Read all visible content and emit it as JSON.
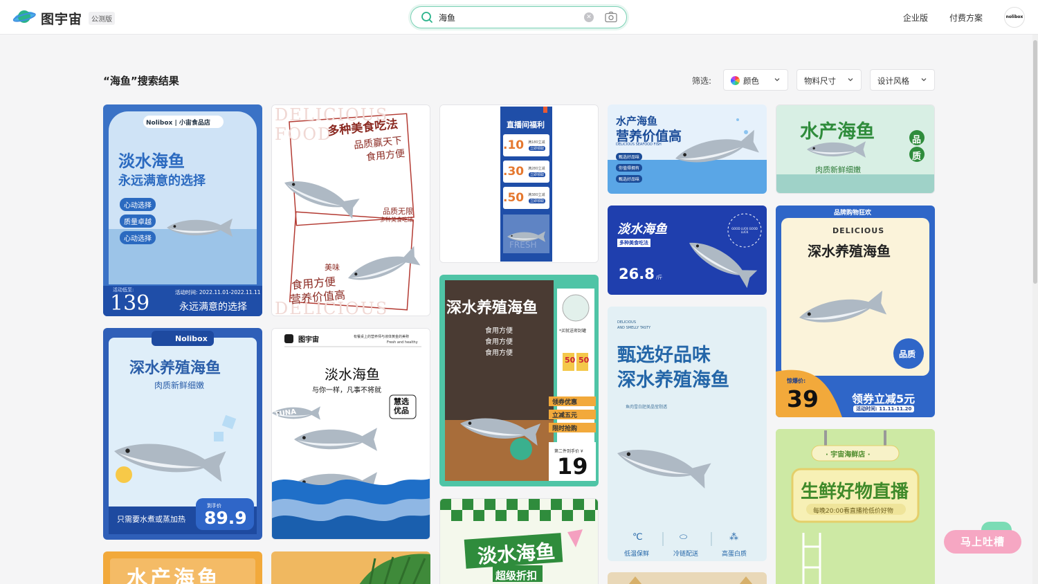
{
  "header": {
    "brand": "图宇宙",
    "beta_badge": "公测版",
    "search": {
      "value": "海鱼",
      "placeholder": ""
    },
    "nav": [
      "企业版",
      "付费方案"
    ],
    "avatar": "nolibox"
  },
  "results": {
    "title": "“海鱼”搜索结果",
    "filter_label": "筛选:",
    "filters": [
      "颜色",
      "物料尺寸",
      "设计风格"
    ]
  },
  "cards": [
    {
      "badge": "Nolibox | 小宙食品店",
      "title": "淡水海鱼",
      "subtitle": "永远满意的选择",
      "tags": [
        "心动选择",
        "质量卓越",
        "心动选择"
      ],
      "price_label": "活动低至:",
      "date": "活动时间: 2022.11.01-2022.11.11",
      "price": "139",
      "tagline": "永远满意的选择"
    },
    {
      "watermark": "DELICIOUS FOOD",
      "line1": "多种美食吃法",
      "line2": "品质赢天下",
      "line3": "食用方便",
      "line4": "品质无限",
      "line5": "多种美食吃法",
      "line6": "美味",
      "line7": "食用方便",
      "line8": "营养价值高"
    },
    {
      "title": "直播间福利",
      "coupons": [
        ".10",
        ".30",
        ".50"
      ],
      "coupon_notes": [
        "满180立减",
        "满280立减",
        "满380立减"
      ],
      "btn": "立即领取",
      "fresh": "FRESH"
    },
    {
      "title1": "水产海鱼",
      "title2": "营养价值高",
      "sub": "DELICIOUS SEAFOOD FISH",
      "tags": [
        "甄选好品味",
        "你值得拥有",
        "甄选好品味"
      ]
    },
    {
      "title": "水产海鱼",
      "badge": [
        "品",
        "质"
      ],
      "sub": "肉质新鲜细嫩"
    },
    {
      "title": "淡水海鱼",
      "sub": "多种美食吃法",
      "price": "26.8",
      "unit": "/斤",
      "ring": "GOOD LUCK GOOD LUCK"
    },
    {
      "top": "品牌购物狂欢",
      "en": "DELICIOUS",
      "title": "深水养殖海鱼",
      "badge": "品质",
      "burst": "惊爆价:",
      "price": "39",
      "coupon": "领券立减5元",
      "date": "活动时间: 11.11-11.20"
    },
    {
      "title": "深水养殖海鱼",
      "checks": [
        "食用方便",
        "食用方便",
        "食用方便"
      ],
      "note": "*买就送密封罐",
      "vouchers": [
        "50",
        "50"
      ],
      "voucher_unit": "元",
      "strips": [
        "领券优惠",
        "立减五元",
        "限时抢购"
      ],
      "price_label": "第二件到手价 ¥",
      "price": "19"
    },
    {
      "en1": "DELICIOUS",
      "en2": "AND SMELLY TASTY",
      "line1": "甄选好品味",
      "line2": "深水养殖海鱼",
      "sub": "鱼肉雪白肥美晶莹剔透",
      "features": [
        "低温保鲜",
        "冷链配送",
        "高蛋白质"
      ]
    },
    {
      "brand": "Nolibox",
      "title": "深水养殖海鱼",
      "sub": "肉质新鲜细嫩",
      "bottom": "只需要水煮或蒸加热",
      "price_label": "到手价",
      "price": "89.9"
    },
    {
      "brand": "图宇宙",
      "slogan": "有餐桌上的营养师与液体黄金的美称",
      "slogan_en": "Fresh and healthy",
      "title": "淡水海鱼",
      "sub": "与你一样，凡事不将就",
      "badge": "慧选优品",
      "tuna": "TUNA"
    },
    {
      "title": "水产海鱼"
    },
    {
      "title": "淡水海鱼",
      "sub": "超级折扣"
    },
    {
      "store": "· 宇宙海鲜店 ·",
      "title": "生鲜好物直播",
      "sub": "每晚20:00看直播抢低价好物"
    }
  ],
  "feedback": "马上吐槽",
  "colors": {
    "accent": "#39b58d",
    "blue": "#1f4ea8",
    "orange": "#f2a93b"
  }
}
